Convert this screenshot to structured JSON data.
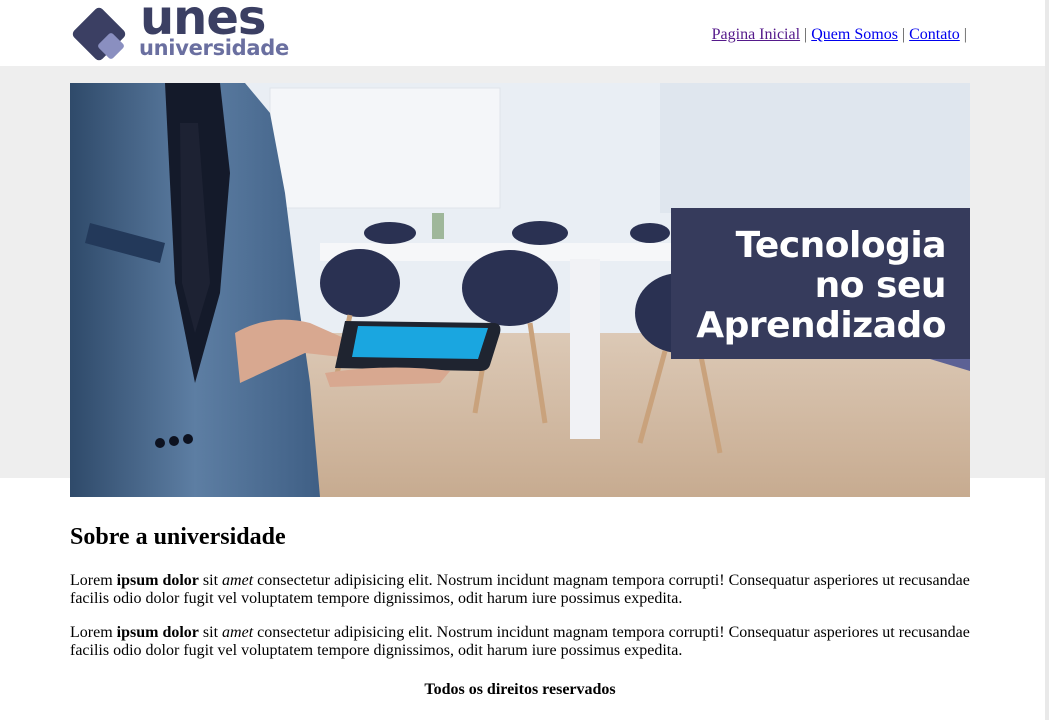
{
  "header": {
    "logo": {
      "name": "unes",
      "subtitle": "universidade"
    },
    "nav": [
      {
        "label": "Pagina Inicial",
        "visited": true
      },
      {
        "label": "Quem Somos",
        "visited": false
      },
      {
        "label": "Contato",
        "visited": false
      }
    ],
    "nav_separator": "|"
  },
  "hero": {
    "caption_lines": [
      "Tecnologia",
      "no seu",
      "Aprendizado"
    ],
    "caption_bg": "#363b5c"
  },
  "main": {
    "title": "Sobre a universidade",
    "paragraphs": [
      {
        "p1": "Lorem ",
        "bold": "ipsum dolor",
        "p2": " sit ",
        "italic": "amet",
        "p3": " consectetur adipisicing elit. Nostrum incidunt magnam tempora corrupti! Consequatur asperiores ut recusandae facilis odio dolor fugit vel voluptatem tempore dignissimos, odit harum iure possimus expedita."
      },
      {
        "p1": "Lorem ",
        "bold": "ipsum dolor",
        "p2": " sit ",
        "italic": "amet",
        "p3": " consectetur adipisicing elit. Nostrum incidunt magnam tempora corrupti! Consequatur asperiores ut recusandae facilis odio dolor fugit vel voluptatem tempore dignissimos, odit harum iure possimus expedita."
      }
    ]
  },
  "footer": {
    "text": "Todos os direitos reservados"
  },
  "colors": {
    "brand": "#3b3f63",
    "brand_light": "#6a6fa0",
    "link": "#0000ee",
    "link_visited": "#551a8b"
  }
}
